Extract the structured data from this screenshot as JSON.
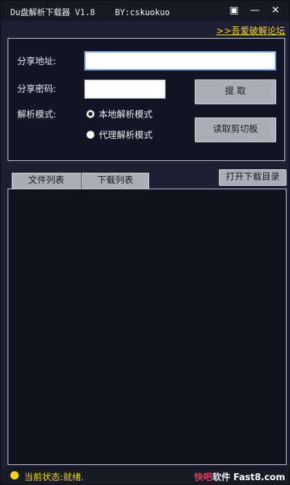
{
  "window": {
    "title": "Du盘解析下载器 V1.8    BY:cskuokuo",
    "controls": {
      "menu": "▣",
      "minimize": "—",
      "close": "✕"
    }
  },
  "header_link": ">>吾爱破解论坛",
  "form": {
    "share_url_label": "分享地址:",
    "share_url_value": "",
    "share_password_label": "分享密码:",
    "share_password_value": "",
    "mode_label": "解析模式:",
    "modes": [
      {
        "label": "本地解析模式",
        "checked": true
      },
      {
        "label": "代理解析模式",
        "checked": false
      }
    ],
    "extract_button": "提  取",
    "clipboard_button": "读取剪切板"
  },
  "tabs": {
    "file_list": "文件列表",
    "download_list": "下载列表",
    "open_download_dir": "打开下载目录"
  },
  "status": {
    "text": "当前状态:就绪."
  },
  "watermark": {
    "part1": "快吧",
    "part2": "软件",
    "part3": "Fast8.com"
  },
  "colors": {
    "background": "#1c2030",
    "accent_yellow": "#ffd21e",
    "status_yellow": "#f6d500",
    "button_gray": "#a9aeb7"
  }
}
